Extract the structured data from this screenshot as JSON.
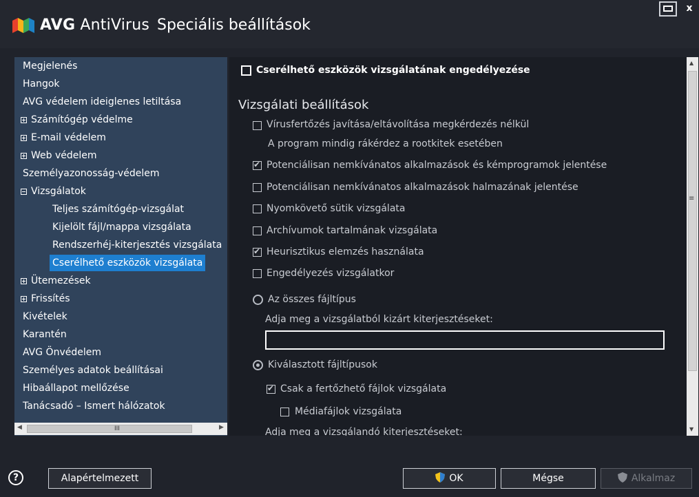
{
  "app": {
    "brand_bold": "AVG",
    "brand_rest": " AntiVirus",
    "title": "Speciális beállítások",
    "close_glyph": "x"
  },
  "nav": {
    "items": [
      {
        "label": "Megjelenés",
        "expander": null
      },
      {
        "label": "Hangok",
        "expander": null
      },
      {
        "label": "AVG védelem ideiglenes letiltása",
        "expander": null
      },
      {
        "label": "Számítógép védelme",
        "expander": "plus"
      },
      {
        "label": "E-mail védelem",
        "expander": "plus"
      },
      {
        "label": "Web védelem",
        "expander": "plus"
      },
      {
        "label": "Személyazonosság-védelem",
        "expander": null
      },
      {
        "label": "Vizsgálatok",
        "expander": "minus"
      },
      {
        "label": "Teljes számítógép-vizsgálat",
        "expander": null
      },
      {
        "label": "Kijelölt fájl/mappa vizsgálata",
        "expander": null
      },
      {
        "label": "Rendszerhéj-kiterjesztés vizsgálata",
        "expander": null
      },
      {
        "label": "Cserélhető eszközök vizsgálata",
        "expander": null,
        "selected": true
      },
      {
        "label": "Ütemezések",
        "expander": "plus"
      },
      {
        "label": "Frissítés",
        "expander": "plus"
      },
      {
        "label": "Kivételek",
        "expander": null
      },
      {
        "label": "Karantén",
        "expander": null
      },
      {
        "label": "AVG Önvédelem",
        "expander": null
      },
      {
        "label": "Személyes adatok beállításai",
        "expander": null
      },
      {
        "label": "Hibaállapot mellőzése",
        "expander": null
      },
      {
        "label": "Tanácsadó – Ismert hálózatok",
        "expander": null
      }
    ],
    "hscroll_grip": "III"
  },
  "content": {
    "enable_label": "Cserélhető eszközök vizsgálatának engedélyezése",
    "enable_checked": false,
    "section_heading": "Vizsgálati beállítások",
    "options": [
      {
        "label": "Vírusfertőzés javítása/eltávolítása megkérdezés nélkül",
        "checked": false
      },
      {
        "label": "Potenciálisan nemkívánatos alkalmazások és kémprogramok jelentése",
        "checked": true
      },
      {
        "label": "Potenciálisan nemkívánatos alkalmazások halmazának jelentése",
        "checked": false
      },
      {
        "label": "Nyomkövető sütik vizsgálata",
        "checked": false
      },
      {
        "label": "Archívumok tartalmának vizsgálata",
        "checked": false
      },
      {
        "label": "Heurisztikus elemzés használata",
        "checked": true
      },
      {
        "label": "Engedélyezés vizsgálatkor",
        "checked": false
      }
    ],
    "rootkit_note": "A program mindig rákérdez a rootkitek esetében",
    "radio_all_label": "Az összes fájltípus",
    "radio_all_checked": false,
    "exclude_label": "Adja meg a vizsgálatból kizárt kiterjesztéseket:",
    "exclude_value": "",
    "radio_selected_label": "Kiválasztott fájltípusok",
    "radio_selected_checked": true,
    "infectable_label": "Csak a fertőzhető fájlok vizsgálata",
    "infectable_checked": true,
    "media_label": "Médiafájlok vizsgálata",
    "media_checked": false,
    "include_label": "Adja meg a vizsgálandó kiterjesztéseket:"
  },
  "footer": {
    "help_glyph": "?",
    "defaults_label": "Alapértelmezett",
    "ok_label": "OK",
    "cancel_label": "Mégse",
    "apply_label": "Alkalmaz"
  },
  "colors": {
    "nav_bg": "#30435b",
    "selected": "#1e7fd0",
    "content_bg": "#1a1d24",
    "frame_bg": "#20232b"
  }
}
